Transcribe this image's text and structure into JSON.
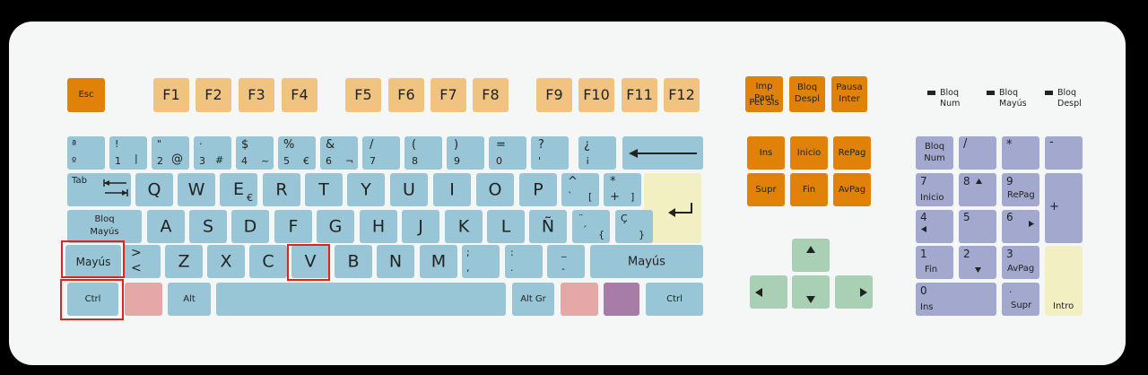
{
  "colors": {
    "main_keys": "#98c6d6",
    "function_keys": "#f0c480",
    "control_keys": "#df8207",
    "arrow_keys": "#a9d0b4",
    "numpad_keys": "#a2a8ce",
    "enter_keys": "#f2f0c2",
    "windows_keys": "#e6a8a6",
    "menu_key": "#a77ca6",
    "highlight": "#e0241b"
  },
  "function_row": {
    "esc": "Esc",
    "f1": "F1",
    "f2": "F2",
    "f3": "F3",
    "f4": "F4",
    "f5": "F5",
    "f6": "F6",
    "f7": "F7",
    "f8": "F8",
    "f9": "F9",
    "f10": "F10",
    "f11": "F11",
    "f12": "F12"
  },
  "system_keys": {
    "imp_pant": "Imp Pant",
    "pet_sis": "Pet Sis",
    "bloq": "Bloq",
    "despl": "Despl",
    "pausa": "Pausa",
    "inter": "Inter"
  },
  "indicators": {
    "num_1": "Bloq",
    "num_2": "Num",
    "mayus_1": "Bloq",
    "mayus_2": "Mayús",
    "despl_1": "Bloq",
    "despl_2": "Despl"
  },
  "number_row": {
    "ord_top": "ª",
    "ord_bot": "º",
    "k1_top": "!",
    "k1_bot": "1",
    "k1_alt": "|",
    "k2_top": "\"",
    "k2_bot": "2",
    "k2_alt": "@",
    "k3_top": "·",
    "k3_bot": "3",
    "k3_alt": "#",
    "k4_top": "$",
    "k4_bot": "4",
    "k4_alt": "~",
    "k5_top": "%",
    "k5_bot": "5",
    "k5_alt": "€",
    "k6_top": "&",
    "k6_bot": "6",
    "k6_alt": "¬",
    "k7_top": "/",
    "k7_bot": "7",
    "k8_top": "(",
    "k8_bot": "8",
    "k9_top": ")",
    "k9_bot": "9",
    "k0_top": "=",
    "k0_bot": "0",
    "q_top": "?",
    "q_bot": "'",
    "iq_top": "¿",
    "iq_bot": "¡"
  },
  "row_q": {
    "tab": "Tab",
    "q": "Q",
    "w": "W",
    "e": "E",
    "e_alt": "€",
    "r": "R",
    "t": "T",
    "y": "Y",
    "u": "U",
    "i": "I",
    "o": "O",
    "p": "P",
    "grave_top": "^",
    "grave_bot": "`",
    "grave_alt": "[",
    "plus_top": "*",
    "plus_bot": "+",
    "plus_alt": "]"
  },
  "row_a": {
    "bloq_mayus_1": "Bloq",
    "bloq_mayus_2": "Mayús",
    "a": "A",
    "s": "S",
    "d": "D",
    "f": "F",
    "g": "G",
    "h": "H",
    "j": "J",
    "k": "K",
    "l": "L",
    "enye": "Ñ",
    "acute_top": "¨",
    "acute_bot": "´",
    "acute_alt": "{",
    "cced_top": "Ç",
    "cced_alt": "}"
  },
  "row_z": {
    "shift_left": "Mayús",
    "lt_top": ">",
    "lt_bot": "<",
    "z": "Z",
    "x": "X",
    "c": "C",
    "v": "V",
    "b": "B",
    "n": "N",
    "m": "M",
    "comma_top": ";",
    "comma_bot": ",",
    "period_top": ":",
    "period_bot": ".",
    "minus_top": "_",
    "minus_bot": "-",
    "shift_right": "Mayús"
  },
  "bottom_row": {
    "ctrl_left": "Ctrl",
    "alt": "Alt",
    "alt_gr": "Alt Gr",
    "ctrl_right": "Ctrl"
  },
  "nav_cluster": {
    "ins": "Ins",
    "inicio": "Inicio",
    "repag": "RePag",
    "supr": "Supr",
    "fin": "Fin",
    "avpag": "AvPag"
  },
  "numpad": {
    "bloq": "Bloq",
    "num": "Num",
    "div": "/",
    "mul": "*",
    "sub": "-",
    "add": "+",
    "n7": "7",
    "n7_sub": "Inicio",
    "n8": "8",
    "n9": "9",
    "n9_sub": "RePag",
    "n4": "4",
    "n5": "5",
    "n6": "6",
    "n1": "1",
    "n1_sub": "Fin",
    "n2": "2",
    "n3": "3",
    "n3_sub": "AvPag",
    "n0": "0",
    "n0_sub": "Ins",
    "dot": ".",
    "dot_sub": "Supr",
    "intro": "Intro"
  }
}
